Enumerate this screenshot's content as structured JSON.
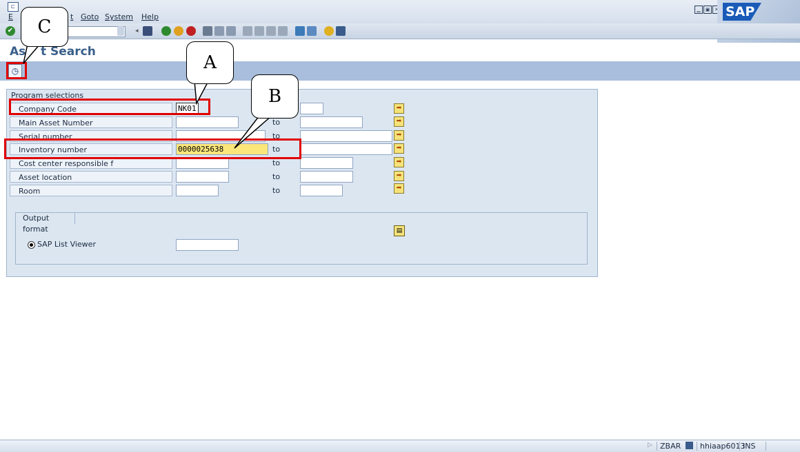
{
  "menu": {
    "items": [
      "Goto",
      "System",
      "Help"
    ],
    "partial": "t",
    "partial2": "E"
  },
  "page_title": "Asset Search",
  "page_title_visible": "As",
  "page_title_visible2": "t Search",
  "selection": {
    "tab_label": "Program selections",
    "rows": [
      {
        "label": "Company Code",
        "from": "NK01",
        "to_label": "",
        "to_value": ""
      },
      {
        "label": "Main Asset Number",
        "from": "",
        "to_label": "to",
        "to_value": ""
      },
      {
        "label": "Serial number",
        "from": "",
        "to_label": "to",
        "to_value": ""
      },
      {
        "label": "Inventory number",
        "from": "0000025638",
        "to_label": "to",
        "to_value": ""
      },
      {
        "label": "Cost center responsible f",
        "from": "",
        "to_label": "to",
        "to_value": ""
      },
      {
        "label": "Asset location",
        "from": "",
        "to_label": "to",
        "to_value": ""
      },
      {
        "label": "Room",
        "from": "",
        "to_label": "to",
        "to_value": ""
      }
    ]
  },
  "output": {
    "tab_label": "Output format",
    "radio_label": "SAP List Viewer",
    "layout_value": ""
  },
  "status": {
    "transaction": "ZBAR",
    "server": "hhiaap6013",
    "mode": "INS"
  },
  "logo": "SAP",
  "callouts": {
    "a": "A",
    "b": "B",
    "c": "C"
  },
  "colors": {
    "annotation_red": "#e00000",
    "app_toolbar": "#a8bedc",
    "highlight_field": "#fbe67a"
  }
}
